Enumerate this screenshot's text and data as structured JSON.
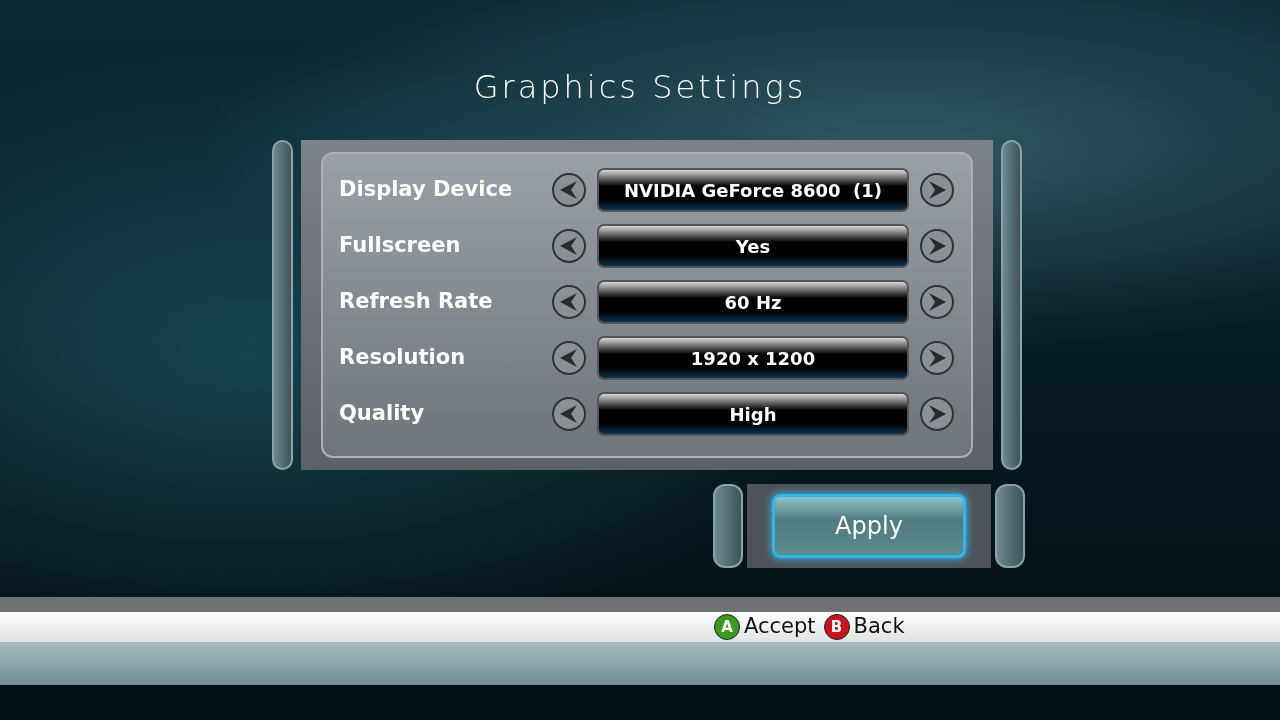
{
  "title": "Graphics Settings",
  "settings": [
    {
      "label": "Display Device",
      "value": "NVIDIA GeForce 8600  (1)"
    },
    {
      "label": "Fullscreen",
      "value": "Yes"
    },
    {
      "label": "Refresh Rate",
      "value": "60 Hz"
    },
    {
      "label": "Resolution",
      "value": "1920 x 1200"
    },
    {
      "label": "Quality",
      "value": "High"
    }
  ],
  "apply_button": {
    "label": "Apply",
    "focused": true
  },
  "legend": [
    {
      "button": "A",
      "label": "Accept",
      "color": "#3a9a1e"
    },
    {
      "button": "B",
      "label": "Back",
      "color": "#c8141c"
    }
  ]
}
